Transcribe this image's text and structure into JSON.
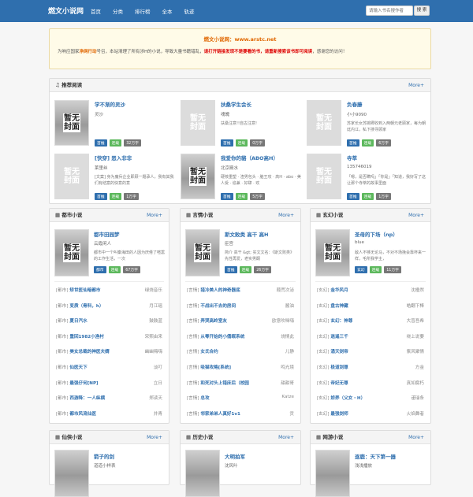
{
  "header": {
    "logo": "燃文小说网",
    "nav": [
      "首页",
      "分类",
      "排行榜",
      "全本",
      "轨迹"
    ],
    "search_placeholder": "请输入书名搜作者",
    "search_btn": "搜 索"
  },
  "notice": {
    "title": "燃文小说网：www.arstc.net",
    "pre": "为响应国家",
    "em1": "净网行动",
    "mid": "号召，本站清理了所有涉H的小说，导致大量书籍错乱，",
    "em2": "请打开链接发现不是要看的书，请重新搜索该书即可阅读",
    "post": "，感谢您的访问！"
  },
  "recommend": {
    "title": "推荐阅读",
    "more": "More+",
    "items": [
      {
        "title": "学不渐的灵沙",
        "author": "灵沙",
        "desc": "",
        "tags": [
          "首推",
          "连载",
          "32万字"
        ],
        "cover": "img"
      },
      {
        "title": "扶桑学生会长",
        "author": "魂魄",
        "desc": "扶桑注意!!自古注意!",
        "tags": [
          "首推",
          "连载",
          "0万字"
        ],
        "cover": "none"
      },
      {
        "title": "负春藤",
        "author": "小小9090",
        "desc": "苏家长女苏婉卿收到入两朝元老顾家，每为朝廷内讧，私下搜寻顾家",
        "tags": [
          "首推",
          "连载",
          "6万字"
        ],
        "cover": "none"
      },
      {
        "title": "[快穿] 恶入非非",
        "author": "莱里丝",
        "desc": "[文案] 身为魔兵企业即顾一题承人，我有其我们有结案的快意的意",
        "tags": [
          "首推",
          "连载",
          "1万字"
        ],
        "cover": "none"
      },
      {
        "title": "我爱你的貉（ABO高H）",
        "author": "北京殿水",
        "desc": "硬核重塑 · 渣男包头 · 脑王攻 · 高H · abo · 美人受 · 追兼 · 好肆 · 欢",
        "tags": [
          "首推",
          "连载",
          "5万字"
        ],
        "cover": "img"
      },
      {
        "title": "寺萃",
        "author": "135746019",
        "desc": "「嗯，是否瞒吗」「你是」「知道，我好写了这让那个寺萃的故事里面",
        "tags": [
          "首推",
          "连载",
          "1万字"
        ],
        "cover": "none"
      }
    ]
  },
  "sections": [
    {
      "title": "都市小说",
      "more": "More+",
      "feat": {
        "title": "都市田园梦",
        "author": "云霞闲人",
        "desc": "都市中一个叫秦海田的人因为厌倦了喧嚣的工作生活，一次",
        "tags": [
          "都市",
          "连载",
          "67万字"
        ]
      },
      "rows": [
        {
          "cat": "[都市]",
          "name": "矫世医仙暗都市",
          "author": "绿烧音乐"
        },
        {
          "cat": "[都市]",
          "name": "变质（骨科，h）",
          "author": "月江瑶"
        },
        {
          "cat": "[都市]",
          "name": "夏日汽水",
          "author": "鼓鼓蓝"
        },
        {
          "cat": "[都市]",
          "name": "重回1982小渔村",
          "author": "宋熙由来"
        },
        {
          "cat": "[都市]",
          "name": "美女总裁的神医夫婿",
          "author": "幽幽嗨嗨"
        },
        {
          "cat": "[都市]",
          "name": "仙医天下",
          "author": "淡叮"
        },
        {
          "cat": "[都市]",
          "name": "最强仔何[NP]",
          "author": "立日"
        },
        {
          "cat": "[都市]",
          "name": "西游降：一人纵横",
          "author": "郑读天"
        },
        {
          "cat": "[都市]",
          "name": "都市风流仙医",
          "author": "井青"
        }
      ]
    },
    {
      "title": "言情小说",
      "more": "More+",
      "feat": {
        "title": "斯文败类 高干 高H",
        "author": "臣宫",
        "desc": "简介 高干 &gt; 实文文名：《斯文败类》先性再爱，老实男酮",
        "tags": [
          "首推",
          "连载",
          "26万字"
        ]
      },
      "rows": [
        {
          "cat": "[言情]",
          "name": "猎冷美人的神奇器底",
          "author": "葭荒次泌"
        },
        {
          "cat": "[言情]",
          "name": "不战出不去的房间",
          "author": "酱油"
        },
        {
          "cat": "[言情]",
          "name": "弄哭高岭室友",
          "author": "欧意吹咪嗨"
        },
        {
          "cat": "[言情]",
          "name": "从零开始的小俑眠系统",
          "author": "烧情此"
        },
        {
          "cat": "[言情]",
          "name": "女氏合约",
          "author": "儿静"
        },
        {
          "cat": "[言情]",
          "name": "吸猫攻略[系统]",
          "author": "鸣光境"
        },
        {
          "cat": "[言情]",
          "name": "和死对头上错床后（校园",
          "author": "甜甜哥"
        },
        {
          "cat": "[言情]",
          "name": "总攻",
          "author": "Katze"
        },
        {
          "cat": "[言情]",
          "name": "邻家弟弟人真好1v1",
          "author": "贡"
        }
      ]
    },
    {
      "title": "玄幻小说",
      "more": "More+",
      "feat": {
        "title": "圣母的下场（np）",
        "author": "blue",
        "desc": "敌人不够无论马，不对不场挽会靠杯来一样，毛所我学主，",
        "tags": [
          "玄幻",
          "连载",
          "11万字"
        ]
      },
      "rows": [
        {
          "cat": "[玄幻]",
          "name": "金华风月",
          "author": "沈楹然"
        },
        {
          "cat": "[玄幻]",
          "name": "盘古神藏",
          "author": "皓翻下棒"
        },
        {
          "cat": "[玄幻]",
          "name": "玄幻：神尊",
          "author": "大盲吾希"
        },
        {
          "cat": "[玄幻]",
          "name": "逍遥三千",
          "author": "绕上说要"
        },
        {
          "cat": "[玄幻]",
          "name": "涌天剑帝",
          "author": "紫风聚情"
        },
        {
          "cat": "[玄幻]",
          "name": "极道剑尊",
          "author": "方金"
        },
        {
          "cat": "[玄幻]",
          "name": "帝妃无尊",
          "author": "真如腐朽"
        },
        {
          "cat": "[玄幻]",
          "name": "娇养（父女・H）",
          "author": "谨瑞条"
        },
        {
          "cat": "[玄幻]",
          "name": "最强剑师",
          "author": "火焰舞者"
        }
      ]
    }
  ],
  "bottom": [
    {
      "title": "仙侠小说",
      "more": "More+",
      "feat_title": "箭子的剑",
      "feat_author": "道道小样表"
    },
    {
      "title": "历史小说",
      "more": "More+",
      "feat_title": "大明拍军",
      "feat_author": "沈风叶"
    },
    {
      "title": "网游小说",
      "more": "More+",
      "feat_title": "逐鹿：天下第一器",
      "feat_author": "浅浅播放"
    }
  ],
  "cover_text": [
    "暂无",
    "封面"
  ]
}
